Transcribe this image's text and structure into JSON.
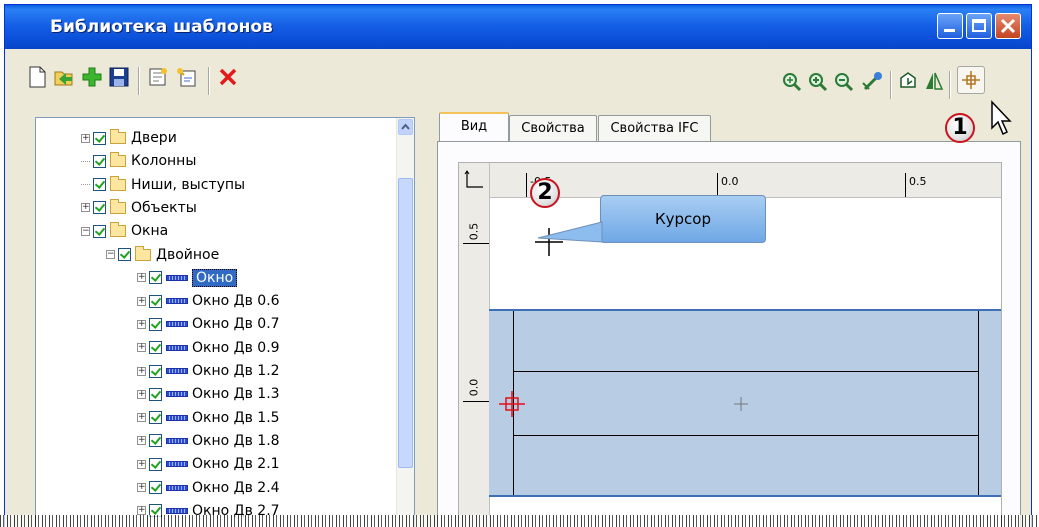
{
  "window": {
    "title": "Библиотека шаблонов"
  },
  "colors": {
    "title_bar": "#0a5fe0",
    "selection": "#316ac5",
    "sheet": "#b8cde4",
    "badge_border": "#c8141e"
  },
  "toolbar_left": [
    "new-icon",
    "open-icon",
    "add-icon",
    "save-icon",
    "new-template-icon",
    "template-edit-icon",
    "delete-icon"
  ],
  "toolbar_right": [
    "zoom-fit-icon",
    "zoom-in-icon",
    "zoom-out-icon",
    "pan-icon",
    "rotate-view-icon",
    "mirror-icon",
    "base-point-icon"
  ],
  "tree": {
    "items": [
      {
        "label": "Двери",
        "level": 0,
        "expander": "+",
        "icon": "folder"
      },
      {
        "label": "Колонны",
        "level": 0,
        "expander": "",
        "icon": "folder"
      },
      {
        "label": "Ниши, выступы",
        "level": 0,
        "expander": "",
        "icon": "folder"
      },
      {
        "label": "Объекты",
        "level": 0,
        "expander": "+",
        "icon": "folder"
      },
      {
        "label": "Окна",
        "level": 0,
        "expander": "−",
        "icon": "folder"
      },
      {
        "label": "Двойное",
        "level": 1,
        "expander": "−",
        "icon": "folder"
      },
      {
        "label": "Окно",
        "level": 2,
        "expander": "+",
        "icon": "window",
        "selected": true
      },
      {
        "label": "Окно Дв 0.6",
        "level": 2,
        "expander": "+",
        "icon": "window"
      },
      {
        "label": "Окно Дв 0.7",
        "level": 2,
        "expander": "+",
        "icon": "window"
      },
      {
        "label": "Окно Дв 0.9",
        "level": 2,
        "expander": "+",
        "icon": "window"
      },
      {
        "label": "Окно Дв 1.2",
        "level": 2,
        "expander": "+",
        "icon": "window"
      },
      {
        "label": "Окно Дв 1.3",
        "level": 2,
        "expander": "+",
        "icon": "window"
      },
      {
        "label": "Окно Дв 1.5",
        "level": 2,
        "expander": "+",
        "icon": "window"
      },
      {
        "label": "Окно Дв 1.8",
        "level": 2,
        "expander": "+",
        "icon": "window"
      },
      {
        "label": "Окно Дв 2.1",
        "level": 2,
        "expander": "+",
        "icon": "window"
      },
      {
        "label": "Окно Дв 2.4",
        "level": 2,
        "expander": "+",
        "icon": "window"
      },
      {
        "label": "Окно Дв 2.7",
        "level": 2,
        "expander": "+",
        "icon": "window"
      }
    ]
  },
  "tabs": [
    {
      "label": "Вид",
      "active": true
    },
    {
      "label": "Свойства",
      "active": false
    },
    {
      "label": "Свойства IFC",
      "active": false
    }
  ],
  "ruler": {
    "h_labels": [
      "-0.5",
      "0.0",
      "0.5"
    ],
    "v_labels": [
      "0.5",
      "0.0"
    ],
    "axis_glyph": "y x"
  },
  "callout": {
    "label": "Курсор"
  },
  "badges": {
    "one": "1",
    "two": "2"
  }
}
